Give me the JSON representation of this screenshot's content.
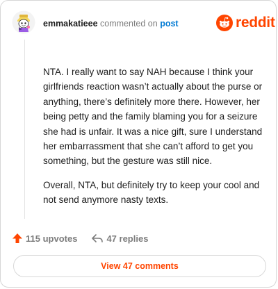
{
  "header": {
    "username": "emmakatieee",
    "action": "commented on",
    "post_link": "post",
    "logo_text": "reddit"
  },
  "comment": {
    "paragraphs": [
      "NTA. I really want to say NAH because I think your girlfriends reaction wasn’t actually about the purse or anything, there’s definitely more there. However, her being petty and the family blaming you for a seizure she had is unfair. It was a nice gift, sure I understand her embarrassment that she can’t afford to get you something, but the gesture was still nice.",
      "Overall, NTA, but definitely try to keep your cool and not send anymore nasty texts."
    ]
  },
  "actions": {
    "upvotes": "115 upvotes",
    "replies": "47 replies"
  },
  "view_button": "View 47 comments",
  "colors": {
    "accent": "#ff4500",
    "link": "#0079d3",
    "muted": "#7c7c7c"
  },
  "icons": [
    "avatar-icon",
    "reddit-snoo-icon",
    "upvote-arrow-icon",
    "reply-icon"
  ]
}
